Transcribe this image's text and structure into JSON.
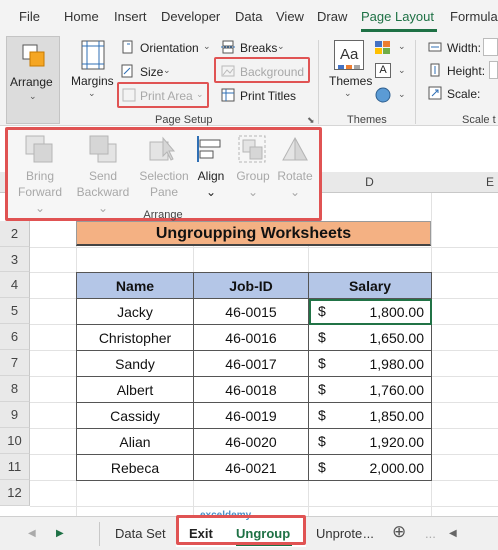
{
  "tabs": {
    "file": "File",
    "home": "Home",
    "insert": "Insert",
    "developer": "Developer",
    "data": "Data",
    "view": "View",
    "draw": "Draw",
    "page_layout": "Page Layout",
    "formulas": "Formula"
  },
  "ribbon": {
    "arrange": "Arrange",
    "margins": "Margins",
    "orientation": "Orientation",
    "size": "Size",
    "print_area": "Print Area",
    "breaks": "Breaks",
    "background": "Background",
    "print_titles": "Print Titles",
    "page_setup_label": "Page Setup",
    "themes": "Themes",
    "themes_label": "Themes",
    "width": "Width:",
    "height": "Height:",
    "scale": "Scale:",
    "scale_label": "Scale t"
  },
  "arrange_popup": {
    "bring_forward_1": "Bring",
    "bring_forward_2": "Forward",
    "send_backward_1": "Send",
    "send_backward_2": "Backward",
    "selection_pane_1": "Selection",
    "selection_pane_2": "Pane",
    "align": "Align",
    "group": "Group",
    "rotate": "Rotate",
    "group_label": "Arrange"
  },
  "grid": {
    "col_d": "D",
    "col_e": "E",
    "rows": [
      "2",
      "3",
      "4",
      "5",
      "6",
      "7",
      "8",
      "9",
      "10",
      "11",
      "12"
    ],
    "title": "Ungroupping  Worksheets"
  },
  "table": {
    "headers": [
      "Name",
      "Job-ID",
      "Salary"
    ],
    "currency": "$",
    "rows": [
      {
        "name": "Jacky",
        "id": "46-0015",
        "salary": "1,800.00"
      },
      {
        "name": "Christopher",
        "id": "46-0016",
        "salary": "1,650.00"
      },
      {
        "name": "Sandy",
        "id": "46-0017",
        "salary": "1,980.00"
      },
      {
        "name": "Albert",
        "id": "46-0018",
        "salary": "1,760.00"
      },
      {
        "name": "Cassidy",
        "id": "46-0019",
        "salary": "1,850.00"
      },
      {
        "name": "Alian",
        "id": "46-0020",
        "salary": "1,920.00"
      },
      {
        "name": "Rebeca",
        "id": "46-0021",
        "salary": "2,000.00"
      }
    ]
  },
  "sheets": {
    "ellipsis": "...",
    "data_set": "Data Set",
    "exit": "Exit",
    "ungroup": "Ungroup",
    "unprotect": "Unprote",
    "more": "...",
    "watermark": "exceldemy"
  },
  "colors": {
    "accent": "#1e7145",
    "highlight_box": "#e05353",
    "title_fill": "#f4b183",
    "header_fill": "#b4c6e7"
  }
}
